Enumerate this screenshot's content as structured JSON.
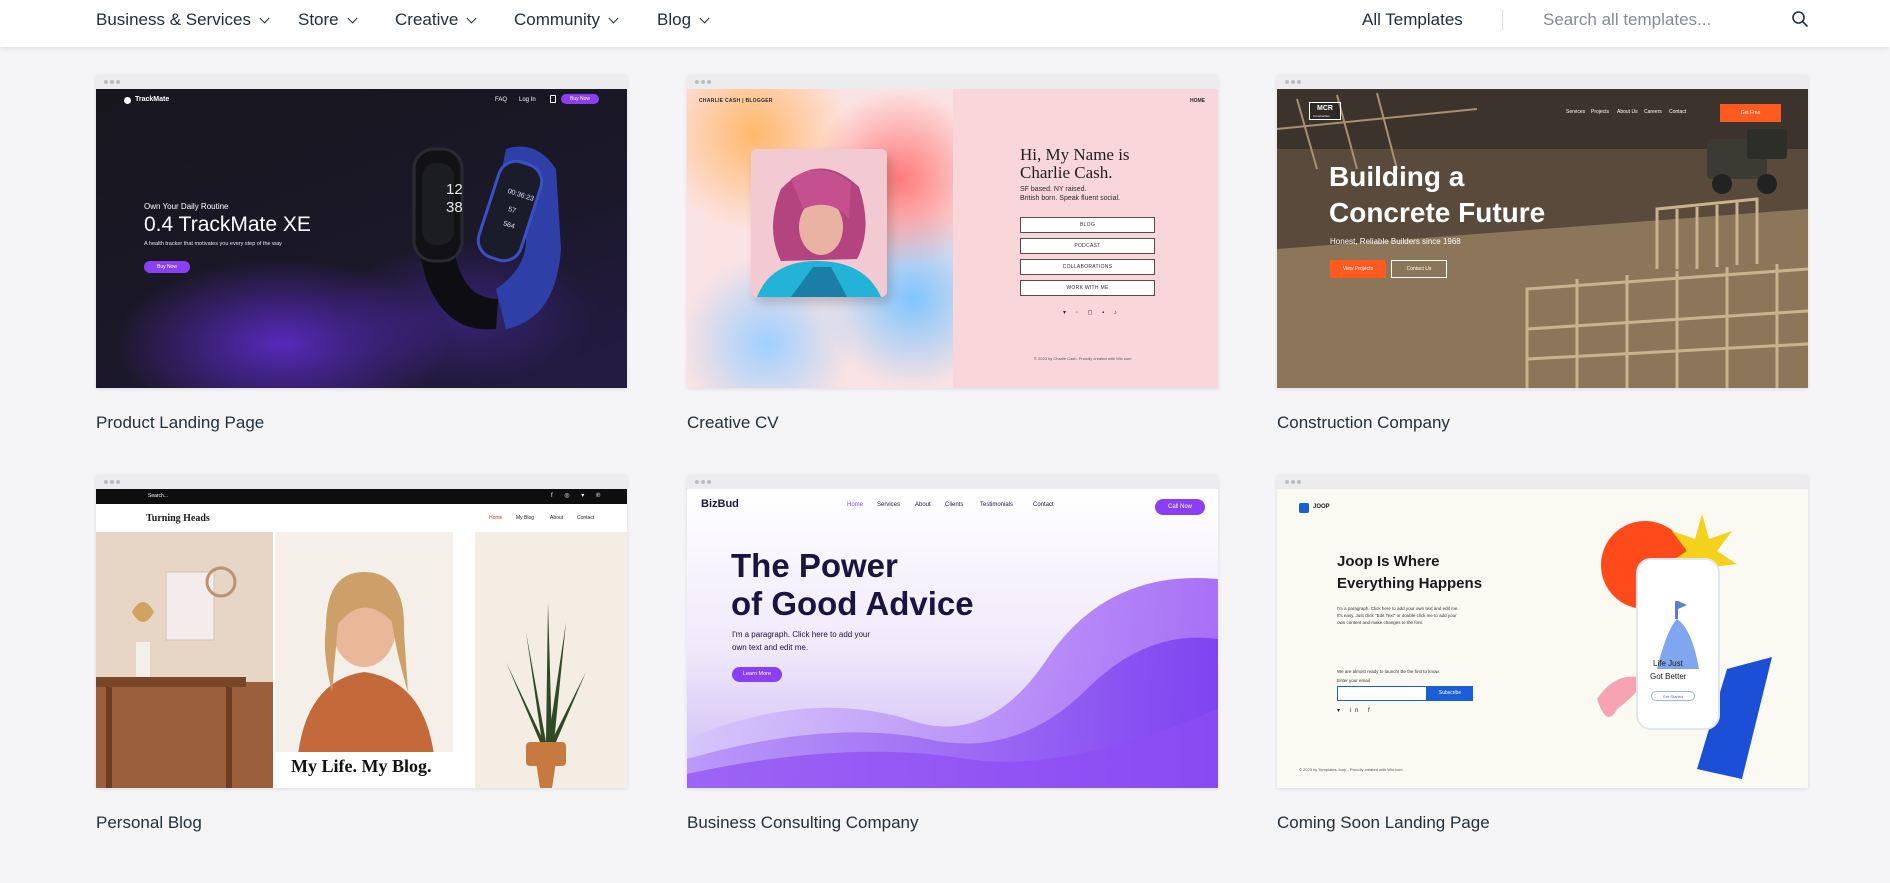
{
  "nav": {
    "items": [
      {
        "label": "Business & Services"
      },
      {
        "label": "Store"
      },
      {
        "label": "Creative"
      },
      {
        "label": "Community"
      },
      {
        "label": "Blog"
      }
    ],
    "all_templates": "All Templates",
    "search_placeholder": "Search all templates..."
  },
  "cards": [
    {
      "title": "Product Landing Page",
      "preview": {
        "brand": "TrackMate",
        "menu": [
          "FAQ",
          "Log In"
        ],
        "cta": "Buy Now",
        "kicker": "Own Your Daily Routine",
        "headline": "0.4 TrackMate XE",
        "sub": "A health tracker that motivates you every step of the way",
        "button": "Buy Now",
        "watch_time_a": "12",
        "watch_time_b": "38",
        "watch_b_line1": "00:36:23",
        "watch_b_line2": "57",
        "watch_b_line3": "564"
      }
    },
    {
      "title": "Creative CV",
      "preview": {
        "brand": "CHARLIE CASH | BLOGGER",
        "menu": "HOME",
        "headline_1": "Hi, My Name is",
        "headline_2": "Charlie Cash.",
        "bio_1": "SF based. NY raised.",
        "bio_2": "British born. Speak fluent social.",
        "buttons": [
          "BLOG",
          "PODCAST",
          "COLLABORATIONS",
          "WORK WITH ME"
        ],
        "footer": "© 2023 by Charlie Cash. Proudly created with Wix.com"
      }
    },
    {
      "title": "Construction Company",
      "preview": {
        "logo_1": "MCR",
        "logo_2": "Construction",
        "menu": [
          "Services",
          "Projects",
          "About Us",
          "Careers",
          "Contact"
        ],
        "cta": "Get Free",
        "headline_1": "Building a",
        "headline_2": "Concrete Future",
        "sub": "Honest, Reliable Builders since 1968",
        "button_primary": "View Projects",
        "button_secondary": "Contact Us"
      }
    },
    {
      "title": "Personal Blog",
      "preview": {
        "search": "Search...",
        "brand": "Turning Heads",
        "menu": [
          "Home",
          "My Blog",
          "About",
          "Contact"
        ],
        "caption": "My Life. My Blog."
      }
    },
    {
      "title": "Business Consulting Company",
      "preview": {
        "brand": "BizBud",
        "menu": [
          "Home",
          "Services",
          "About",
          "Clients",
          "Testimonials",
          "Contact"
        ],
        "cta": "Call Now",
        "headline_1": "The Power",
        "headline_2": "of Good Advice",
        "para_1": "I'm a paragraph. Click here to add your",
        "para_2": "own text and edit me.",
        "button": "Learn More"
      }
    },
    {
      "title": "Coming Soon Landing Page",
      "preview": {
        "brand": "JOOP",
        "headline_1": "Joop Is Where",
        "headline_2": "Everything Happens",
        "para_1": "I'm a paragraph. Click here to add your own text and edit me.",
        "para_2": "It's easy. Just click \"Edit Text\" or double click me to add your",
        "para_3": "own content and make changes to the font.",
        "launch": "We are almost ready to launch! Be the first to know.",
        "email_label": "Enter your email",
        "subscribe": "Subscribe",
        "phone_1": "Life Just",
        "phone_2": "Got Better",
        "phone_btn": "Get Started",
        "footer": "© 2023 by Templates Joop - Proudly created with Wix.com"
      }
    }
  ],
  "colors": {
    "accent_purple": "#8b3ff5",
    "accent_orange": "#ff5a1f",
    "accent_blue": "#1a5fd6"
  }
}
